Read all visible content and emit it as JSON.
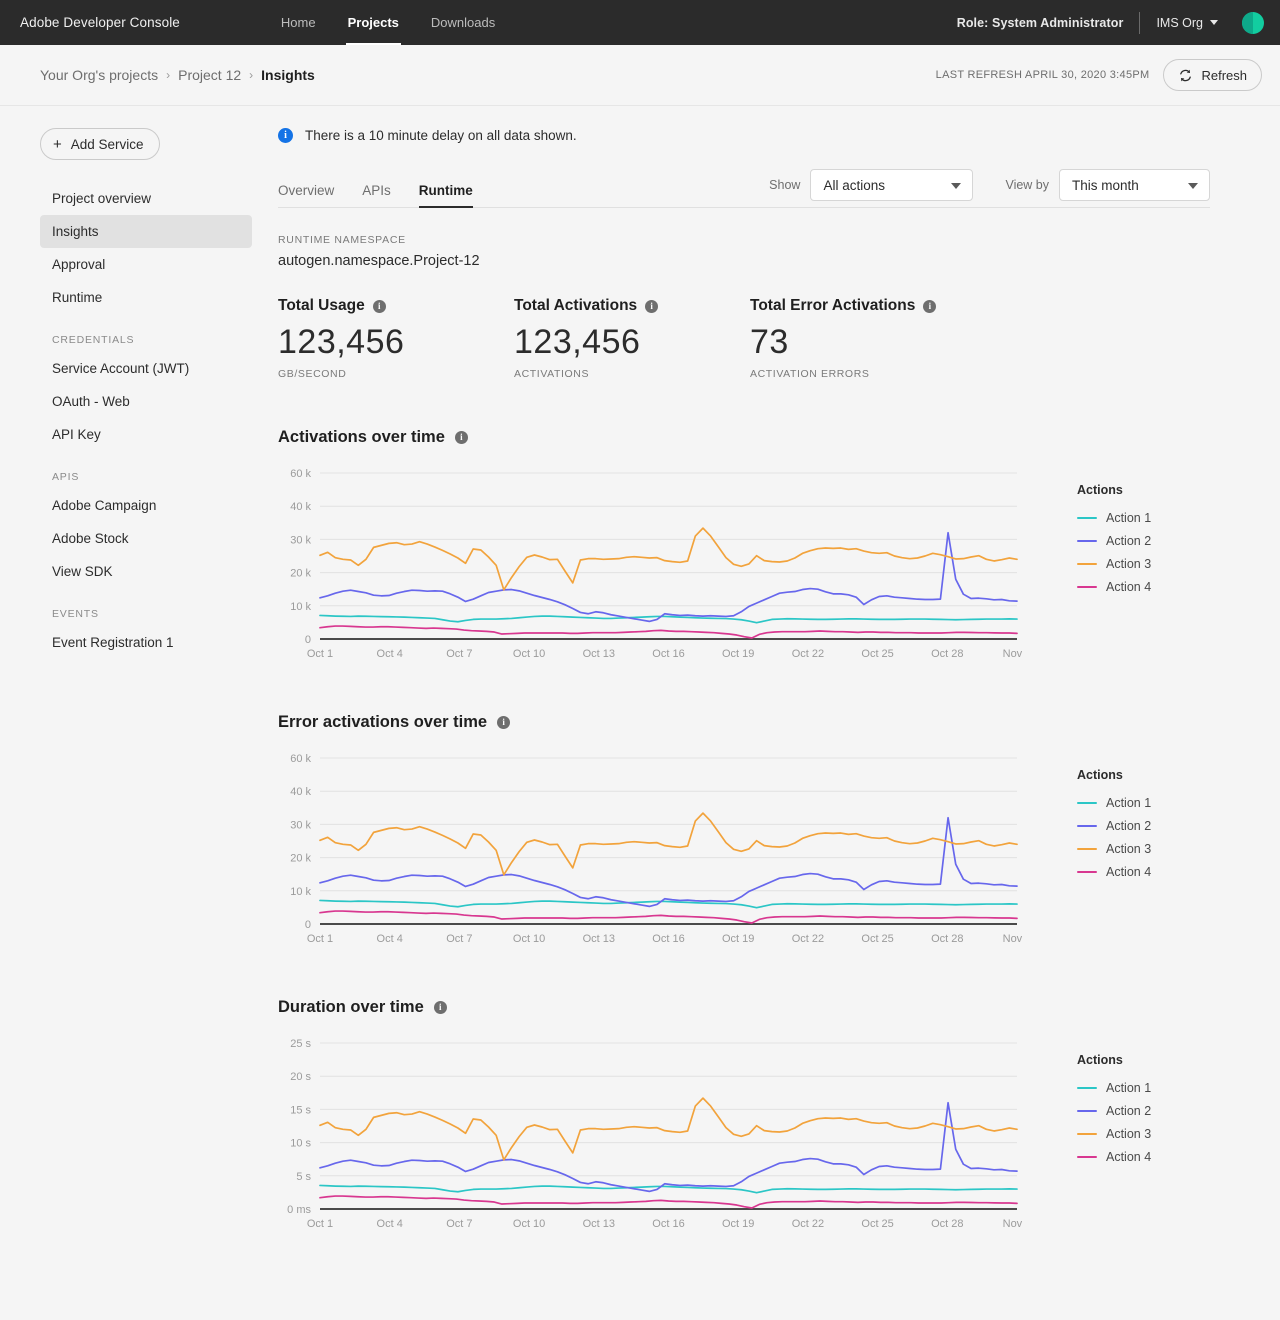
{
  "topbar": {
    "brand": "Adobe Developer Console",
    "nav": [
      {
        "label": "Home",
        "active": false
      },
      {
        "label": "Projects",
        "active": true
      },
      {
        "label": "Downloads",
        "active": false
      }
    ],
    "role": "Role: System Administrator",
    "org": "IMS Org",
    "avatar_icon": "user-avatar"
  },
  "breadcrumb": {
    "items": [
      "Your Org's projects",
      "Project 12",
      "Insights"
    ],
    "separator": "›",
    "last_refresh": "LAST REFRESH APRIL 30, 2020 3:45PM",
    "refresh_label": "Refresh",
    "refresh_icon": "refresh-icon"
  },
  "sidebar": {
    "add_service_label": "Add Service",
    "add_service_icon": "plus-icon",
    "items": [
      {
        "label": "Project overview",
        "selected": false
      },
      {
        "label": "Insights",
        "selected": true
      },
      {
        "label": "Approval",
        "selected": false
      },
      {
        "label": "Runtime",
        "selected": false
      }
    ],
    "groups": [
      {
        "title": "CREDENTIALS",
        "items": [
          {
            "label": "Service Account (JWT)"
          },
          {
            "label": "OAuth - Web"
          },
          {
            "label": "API Key"
          }
        ]
      },
      {
        "title": "APIS",
        "items": [
          {
            "label": "Adobe Campaign"
          },
          {
            "label": "Adobe Stock"
          },
          {
            "label": "View SDK"
          }
        ]
      },
      {
        "title": "EVENTS",
        "items": [
          {
            "label": "Event Registration 1"
          }
        ]
      }
    ]
  },
  "notice": {
    "icon": "info-icon",
    "text": "There is a 10 minute delay on all data shown."
  },
  "tabs": [
    {
      "label": "Overview",
      "active": false
    },
    {
      "label": "APIs",
      "active": false
    },
    {
      "label": "Runtime",
      "active": true
    }
  ],
  "controls": {
    "show_label": "Show",
    "show_value": "All actions",
    "show_options": [
      "All actions"
    ],
    "viewby_label": "View by",
    "viewby_value": "This month",
    "viewby_options": [
      "This month"
    ]
  },
  "namespace": {
    "label": "RUNTIME NAMESPACE",
    "value": "autogen.namespace.Project-12"
  },
  "metrics": [
    {
      "title": "Total Usage",
      "value": "123,456",
      "unit": "GB/SECOND",
      "info_icon": "info-icon"
    },
    {
      "title": "Total Activations",
      "value": "123,456",
      "unit": "ACTIVATIONS",
      "info_icon": "info-icon"
    },
    {
      "title": "Total Error Activations",
      "value": "73",
      "unit": "ACTIVATION ERRORS",
      "info_icon": "info-icon"
    }
  ],
  "legend": {
    "title": "Actions",
    "items": [
      {
        "label": "Action 1",
        "color": "#2bc6c6"
      },
      {
        "label": "Action 2",
        "color": "#6767ec"
      },
      {
        "label": "Action 3",
        "color": "#f2a33c"
      },
      {
        "label": "Action 4",
        "color": "#d83790"
      }
    ]
  },
  "chart_data": [
    {
      "type": "line",
      "title": "Activations over time",
      "xlabel": "",
      "ylabel": "",
      "grid": true,
      "legend_position": "right",
      "ylim": [
        0,
        60000
      ],
      "yticks": [
        0,
        10000,
        20000,
        30000,
        40000,
        60000
      ],
      "ytick_labels": [
        "0",
        "10 k",
        "20 k",
        "30 k",
        "40 k",
        "60 k"
      ],
      "xticks": [
        "Oct 1",
        "Oct 4",
        "Oct 7",
        "Oct 10",
        "Oct 13",
        "Oct 16",
        "Oct 19",
        "Oct 22",
        "Oct 25",
        "Oct 28",
        "Nov 1"
      ],
      "x": [
        "Oct 1",
        "Oct 2",
        "Oct 3",
        "Oct 4",
        "Oct 5",
        "Oct 6",
        "Oct 7",
        "Oct 8",
        "Oct 9",
        "Oct 10",
        "Oct 11",
        "Oct 12",
        "Oct 13",
        "Oct 14",
        "Oct 15",
        "Oct 16",
        "Oct 17",
        "Oct 18",
        "Oct 19",
        "Oct 20",
        "Oct 21",
        "Oct 22",
        "Oct 23",
        "Oct 24",
        "Oct 25",
        "Oct 26",
        "Oct 27",
        "Oct 28",
        "Oct 29",
        "Oct 30",
        "Oct 31",
        "Nov 1"
      ],
      "series": [
        {
          "name": "Action 1",
          "color": "#2bc6c6",
          "values": [
            7100,
            7000,
            6900,
            6850,
            6800,
            6900,
            6850,
            6800,
            6750,
            6700,
            6650,
            6600,
            6500,
            6400,
            6300,
            6200,
            5800,
            5400,
            5200,
            5600,
            5900,
            6000,
            6000,
            6000,
            6100,
            6200,
            6400,
            6600,
            6800,
            6900,
            6900,
            6800,
            6700,
            6600,
            6500,
            6400,
            6300,
            6200,
            6200,
            6300,
            6400,
            6500,
            6600,
            6700,
            6800,
            6800,
            6700,
            6600,
            6500,
            6400,
            6300,
            6250,
            6200,
            6150,
            6000,
            5800,
            5400,
            4900,
            5400,
            5900,
            6000,
            6100,
            6050,
            6000,
            5950,
            5900,
            5900,
            5950,
            6000,
            6050,
            6050,
            6000,
            5950,
            5900,
            5900,
            5900,
            5950,
            6000,
            6000,
            6000,
            5950,
            5900,
            5850,
            5800,
            5850,
            5900,
            5950,
            6000,
            6000,
            6000,
            6050,
            6000
          ]
        },
        {
          "name": "Action 2",
          "color": "#6767ec",
          "values": [
            12400,
            13000,
            13800,
            14400,
            14700,
            14300,
            13900,
            13200,
            13000,
            13100,
            13800,
            14300,
            14700,
            14600,
            14400,
            14500,
            14400,
            13600,
            12600,
            11300,
            12000,
            13000,
            14000,
            14400,
            14800,
            14900,
            14500,
            13800,
            13100,
            12500,
            11900,
            11200,
            10300,
            9200,
            8000,
            7600,
            8200,
            7900,
            7300,
            6900,
            6500,
            6100,
            5700,
            5300,
            5900,
            7600,
            7300,
            7100,
            7200,
            7000,
            6900,
            7000,
            6900,
            6800,
            7000,
            8200,
            9800,
            10800,
            11800,
            12800,
            13800,
            14100,
            14300,
            14900,
            15200,
            15000,
            14200,
            13600,
            13600,
            13300,
            12600,
            10400,
            11800,
            12800,
            13000,
            12600,
            12400,
            12200,
            12000,
            11900,
            11900,
            12000,
            32000,
            18000,
            13500,
            12200,
            12300,
            12100,
            11800,
            11900,
            11500,
            11400
          ]
        },
        {
          "name": "Action 3",
          "color": "#f2a33c",
          "values": [
            25200,
            26100,
            24500,
            24000,
            23800,
            22200,
            24000,
            27600,
            28200,
            28800,
            29000,
            28400,
            28600,
            29300,
            28600,
            27700,
            26700,
            25600,
            24400,
            22800,
            27100,
            26800,
            24700,
            22200,
            14800,
            18500,
            21800,
            24600,
            25300,
            24700,
            23900,
            24000,
            20400,
            16900,
            23800,
            24200,
            24200,
            24000,
            24100,
            24200,
            24600,
            24800,
            24600,
            24400,
            24500,
            23600,
            23300,
            23100,
            23500,
            31000,
            33400,
            31000,
            27800,
            24500,
            22500,
            21900,
            22600,
            25100,
            23600,
            23300,
            23200,
            23500,
            24400,
            25800,
            26600,
            27200,
            27400,
            27300,
            27400,
            27000,
            27200,
            26500,
            26000,
            25800,
            26000,
            25000,
            24500,
            24200,
            24400,
            25000,
            25800,
            25400,
            24800,
            24100,
            24200,
            24700,
            25100,
            24000,
            23500,
            23900,
            24400,
            24000
          ]
        },
        {
          "name": "Action 4",
          "color": "#d83790",
          "values": [
            3400,
            3700,
            3900,
            3900,
            3800,
            3700,
            3600,
            3600,
            3700,
            3700,
            3600,
            3500,
            3400,
            3300,
            3200,
            3300,
            3200,
            3100,
            3000,
            2700,
            2500,
            2400,
            2300,
            2100,
            1500,
            1600,
            1700,
            1800,
            1800,
            1800,
            1800,
            1800,
            1800,
            1700,
            1700,
            1800,
            1900,
            1900,
            1900,
            1900,
            2000,
            2100,
            2200,
            2300,
            2500,
            2600,
            2400,
            2300,
            2300,
            2200,
            2100,
            2000,
            1900,
            1700,
            1500,
            1200,
            700,
            300,
            1400,
            1900,
            2100,
            2200,
            2200,
            2200,
            2200,
            2300,
            2400,
            2300,
            2200,
            2200,
            2100,
            2000,
            2100,
            2100,
            2000,
            2000,
            1900,
            1900,
            1900,
            1800,
            1800,
            1800,
            1800,
            1900,
            2000,
            2000,
            1950,
            1900,
            1900,
            1850,
            1800,
            1800,
            1700
          ]
        }
      ]
    },
    {
      "type": "line",
      "title": "Error activations over time",
      "xlabel": "",
      "ylabel": "",
      "grid": true,
      "legend_position": "right",
      "ylim": [
        0,
        60000
      ],
      "yticks": [
        0,
        10000,
        20000,
        30000,
        40000,
        60000
      ],
      "ytick_labels": [
        "0",
        "10 k",
        "20 k",
        "30 k",
        "40 k",
        "60 k"
      ],
      "xticks": [
        "Oct 1",
        "Oct 4",
        "Oct 7",
        "Oct 10",
        "Oct 13",
        "Oct 16",
        "Oct 19",
        "Oct 22",
        "Oct 25",
        "Oct 28",
        "Nov 1"
      ],
      "same_shape_as": 0
    },
    {
      "type": "line",
      "title": "Duration over time",
      "xlabel": "",
      "ylabel": "",
      "grid": true,
      "legend_position": "right",
      "ylim": [
        0,
        25
      ],
      "yticks": [
        0,
        5,
        10,
        15,
        20,
        25
      ],
      "ytick_labels": [
        "0 ms",
        "5 s",
        "10 s",
        "15 s",
        "20 s",
        "25 s"
      ],
      "xticks": [
        "Oct 1",
        "Oct 4",
        "Oct 7",
        "Oct 10",
        "Oct 13",
        "Oct 16",
        "Oct 19",
        "Oct 22",
        "Oct 25",
        "Oct 28",
        "Nov 1"
      ],
      "unit_scale": 0.0005,
      "same_shape_as": 0
    }
  ]
}
